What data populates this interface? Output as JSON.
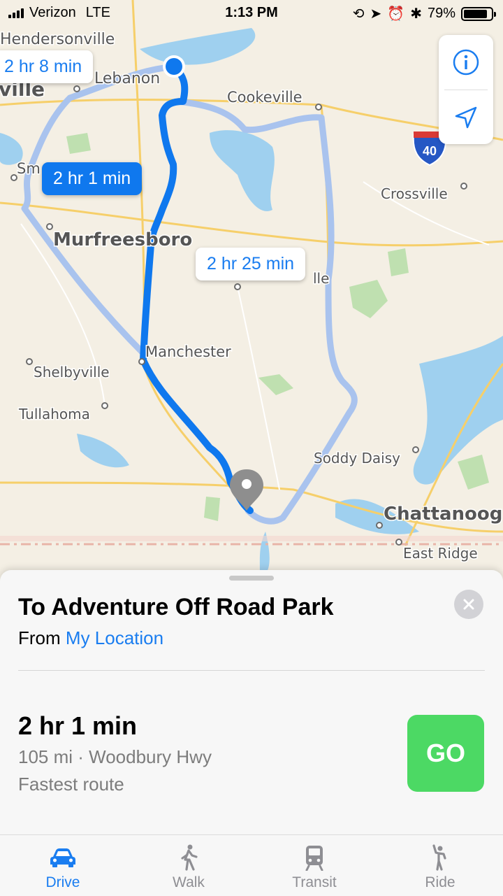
{
  "status": {
    "carrier": "Verizon",
    "network": "LTE",
    "time": "1:13 PM",
    "battery": "79%"
  },
  "map": {
    "callouts": [
      "2 hr 8 min",
      "2 hr 1 min",
      "2 hr 25 min"
    ],
    "places": [
      "Hendersonville",
      "Lebanon",
      "ville",
      "Cookeville",
      "Sm",
      "Crossville",
      "Murfreesboro",
      "lle",
      "Manchester",
      "Shelbyville",
      "Tullahoma",
      "Soddy Daisy",
      "Chattanoog",
      "East Ridge"
    ],
    "highway_shield": "40"
  },
  "sheet": {
    "destination": "To Adventure Off Road Park",
    "from_label": "From",
    "from_location": "My Location",
    "route_time": "2 hr 1 min",
    "route_detail": "105 mi · Woodbury Hwy",
    "route_note": "Fastest route",
    "go_label": "GO"
  },
  "tabs": [
    {
      "label": "Drive",
      "icon": "car-icon",
      "active": true
    },
    {
      "label": "Walk",
      "icon": "walk-icon",
      "active": false
    },
    {
      "label": "Transit",
      "icon": "train-icon",
      "active": false
    },
    {
      "label": "Ride",
      "icon": "ride-icon",
      "active": false
    }
  ],
  "colors": {
    "accent": "#1a7df0",
    "go": "#4cd964",
    "route_selected": "#0f78ee",
    "route_alt": "#a9c3ee"
  }
}
